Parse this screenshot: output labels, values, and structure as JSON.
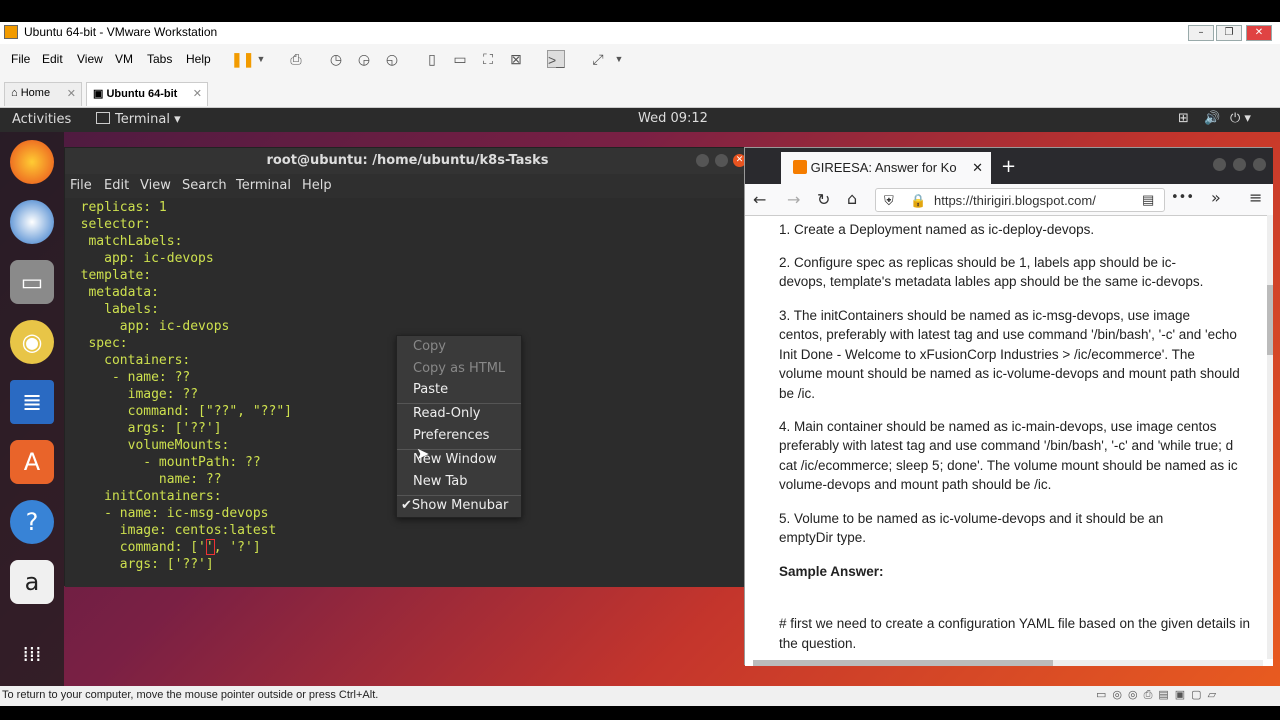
{
  "vmware": {
    "title": "Ubuntu 64-bit - VMware Workstation",
    "menu": [
      "File",
      "Edit",
      "View",
      "VM",
      "Tabs",
      "Help"
    ],
    "tabs": [
      {
        "label": "Home"
      },
      {
        "label": "Ubuntu 64-bit"
      }
    ],
    "status": "To return to your computer, move the mouse pointer outside or press Ctrl+Alt."
  },
  "ubuntu": {
    "activities": "Activities",
    "app_menu": "Terminal ▾",
    "clock": "Wed 09:12"
  },
  "terminal": {
    "title": "root@ubuntu: /home/ubuntu/k8s-Tasks",
    "menu": [
      "File",
      "Edit",
      "View",
      "Search",
      "Terminal",
      "Help"
    ],
    "lines": [
      "  replicas: 1",
      "  selector:",
      "   matchLabels:",
      "     app: ic-devops",
      "  template:",
      "   metadata:",
      "     labels:",
      "       app: ic-devops",
      "   spec:",
      "     containers:",
      "      - name: ??",
      "        image: ??",
      "        command: [\"??\", \"??\"]",
      "        args: ['??']",
      "        volumeMounts:",
      "          - mountPath: ??",
      "            name: ??",
      "     initContainers:",
      "     - name: ic-msg-devops",
      "       image: centos:latest",
      "       command: ['', '?']",
      "       args: ['??']"
    ]
  },
  "context_menu": {
    "items": [
      {
        "label": "Copy",
        "disabled": true
      },
      {
        "label": "Copy as HTML",
        "disabled": true
      },
      {
        "label": "Paste",
        "disabled": false
      },
      {
        "label": "Read-Only",
        "disabled": false
      },
      {
        "label": "Preferences",
        "disabled": false
      },
      {
        "label": "New Window",
        "disabled": false
      },
      {
        "label": "New Tab",
        "disabled": false
      },
      {
        "label": "✔Show Menubar",
        "disabled": false
      }
    ]
  },
  "firefox": {
    "tab_title": "GIREESA: Answer for Ko",
    "url": "https://thirigiri.blogspot.com/",
    "paragraphs": [
      "1. Create a Deployment named as ic-deploy-devops.",
      "    2. Configure spec as replicas should be 1, labels app should be ic-",
      "devops, template's metadata lables app should be the same ic-devops.",
      "    3. The initContainers should be named as ic-msg-devops, use image",
      "centos, preferably with latest tag and use command '/bin/bash', '-c' and 'echo",
      "Init Done - Welcome to xFusionCorp Industries > /ic/ecommerce'. The",
      "volume mount should be named as ic-volume-devops and mount path should",
      "be /ic.",
      "    4. Main container should be named as ic-main-devops, use image centos",
      "preferably with latest tag and use command '/bin/bash', '-c' and 'while true; d",
      "cat /ic/ecommerce; sleep 5; done'. The volume mount should be named as ic",
      "volume-devops and mount path should be /ic.",
      "    5. Volume to be named as ic-volume-devops and it should be an",
      "emptyDir type.",
      "Sample Answer:",
      "# first we need to create a configuration YAML file based on the given details in",
      "the question."
    ]
  }
}
